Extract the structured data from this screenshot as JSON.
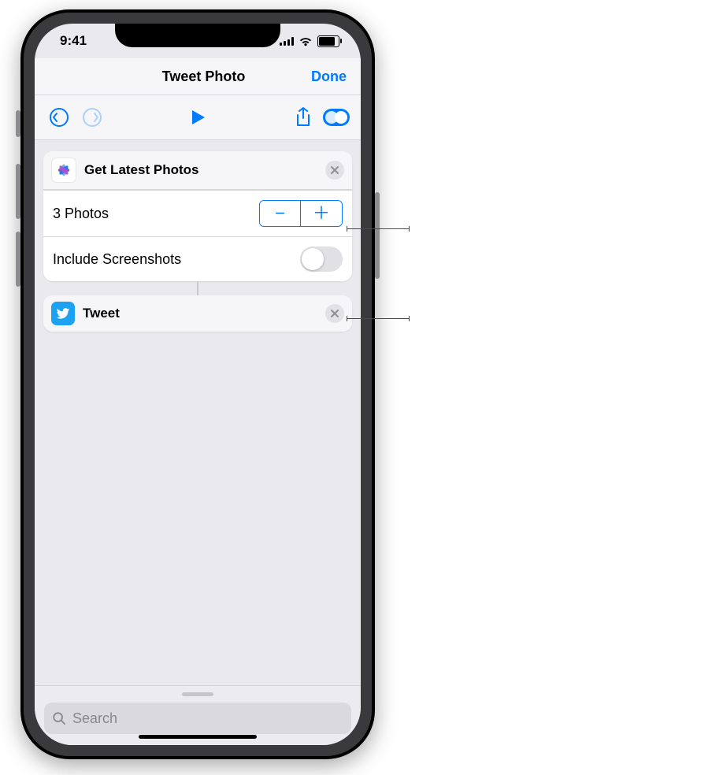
{
  "statusbar": {
    "time": "9:41"
  },
  "nav": {
    "title": "Tweet Photo",
    "done": "Done"
  },
  "actions": {
    "get_latest_photos": {
      "title": "Get Latest Photos",
      "count_label": "3 Photos",
      "include_screenshots_label": "Include Screenshots",
      "include_screenshots_on": false
    },
    "tweet": {
      "title": "Tweet"
    }
  },
  "drawer": {
    "search_placeholder": "Search"
  }
}
